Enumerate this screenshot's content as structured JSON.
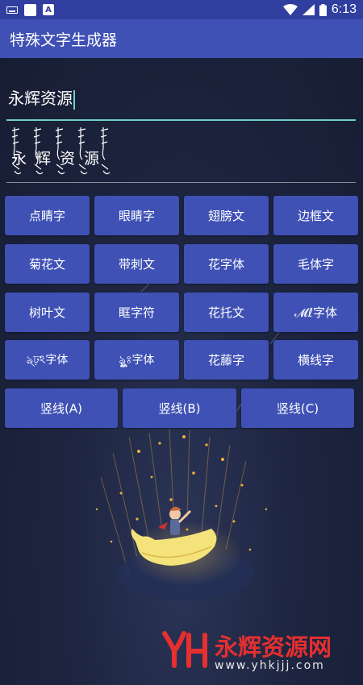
{
  "status_bar": {
    "time": "6:13"
  },
  "app_bar": {
    "title": "特殊文字生成器"
  },
  "input": {
    "value": "永辉资源"
  },
  "output": {
    "value": "永辉资源"
  },
  "buttons": [
    "点睛字",
    "眼睛字",
    "翅膀文",
    "边框文",
    "菊花文",
    "带刺文",
    "花字体",
    "毛体字",
    "树叶文",
    "眶字符",
    "花托文",
    "𝓜ℓ字体",
    "ঌ্ঢ়ঽ字体",
    "ৡৢৣৢ্ঃ字体",
    "花藤字",
    "横线字"
  ],
  "vertical_buttons": [
    "竖线(A)",
    "竖线(B)",
    "竖线(C)"
  ],
  "watermark": {
    "title": "永辉资源网",
    "url": "www.yhkjjj.com",
    "logo": "YH"
  },
  "colors": {
    "primary": "#3f51b5",
    "primary_dark": "#303f9f",
    "accent": "#6fcfc3",
    "watermark": "#e62f2f"
  }
}
